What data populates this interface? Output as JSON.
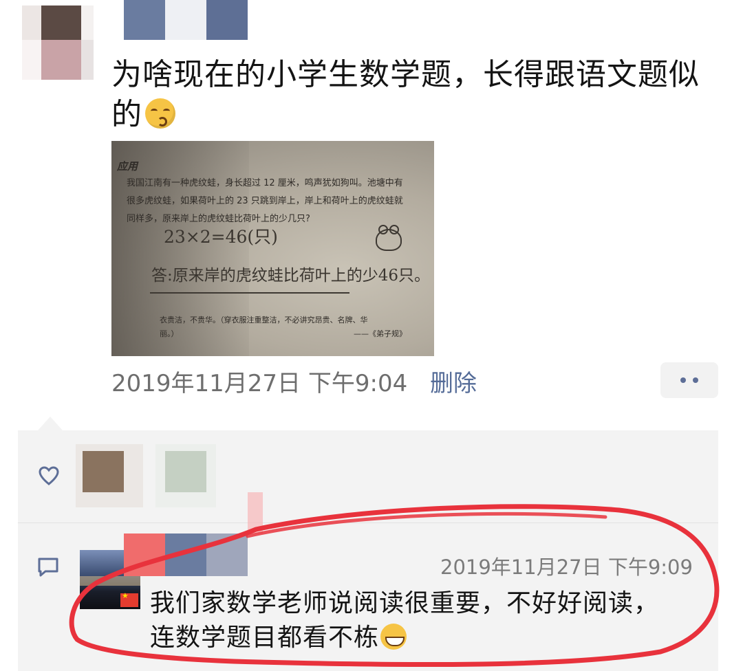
{
  "post": {
    "text_line1": "为啥现在的小学生数学题，长得跟语文题似",
    "text_line2": "的",
    "timestamp": "2019年11月27日 下午9:04",
    "delete_label": "删除",
    "photo": {
      "heading": "应用",
      "question_line1": "我国江南有一种虎纹蛙，身长超过 12 厘米，鸣声犹如狗叫。池塘中有",
      "question_line2": "很多虎纹蛙，如果荷叶上的 23 只跳到岸上，岸上和荷叶上的虎纹蛙就",
      "question_line3": "同样多，原来岸上的虎纹蛙比荷叶上的少几只?",
      "handwritten_calc": "23×2=46(只)",
      "handwritten_answer": "答:原来岸的虎纹蛙比荷叶上的少46只。",
      "footer_line1": "衣贵洁，不贵华。（穿衣服注重整洁，不必讲究昂贵、名牌、华",
      "footer_line2": "丽。）",
      "footer_source": "——《弟子规》"
    }
  },
  "comment": {
    "time": "2019年11月27日 下午9:09",
    "text_line1": "我们家数学老师说阅读很重要，不好好阅读，",
    "text_line2": "连数学题目都看不栋"
  },
  "colors": {
    "link": "#556c98",
    "annotation_red": "#e8323c"
  },
  "icons": [
    "heart-outline-icon",
    "comment-icon",
    "more-dots-icon",
    "china-flag-icon"
  ]
}
